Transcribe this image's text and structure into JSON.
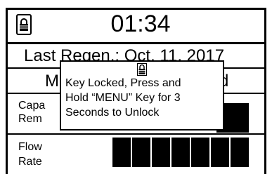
{
  "header": {
    "time": "01:34",
    "lock_icon": "lock-icon"
  },
  "regen": {
    "text": "Last Regen.: Oct. 11, 2017"
  },
  "mode": {
    "text": "M",
    "tail": "d"
  },
  "capacity": {
    "label_line1": "Capa",
    "label_line2": "Rem"
  },
  "flow": {
    "label_line1": "Flow",
    "label_line2": "Rate",
    "segments": 7
  },
  "dialog": {
    "icon": "lock-icon",
    "line1": "Key Locked, Press and",
    "line2": "Hold “MENU” Key for 3",
    "line3": "Seconds to Unlock"
  },
  "colors": {
    "foreground": "#000000",
    "background": "#ffffff"
  }
}
